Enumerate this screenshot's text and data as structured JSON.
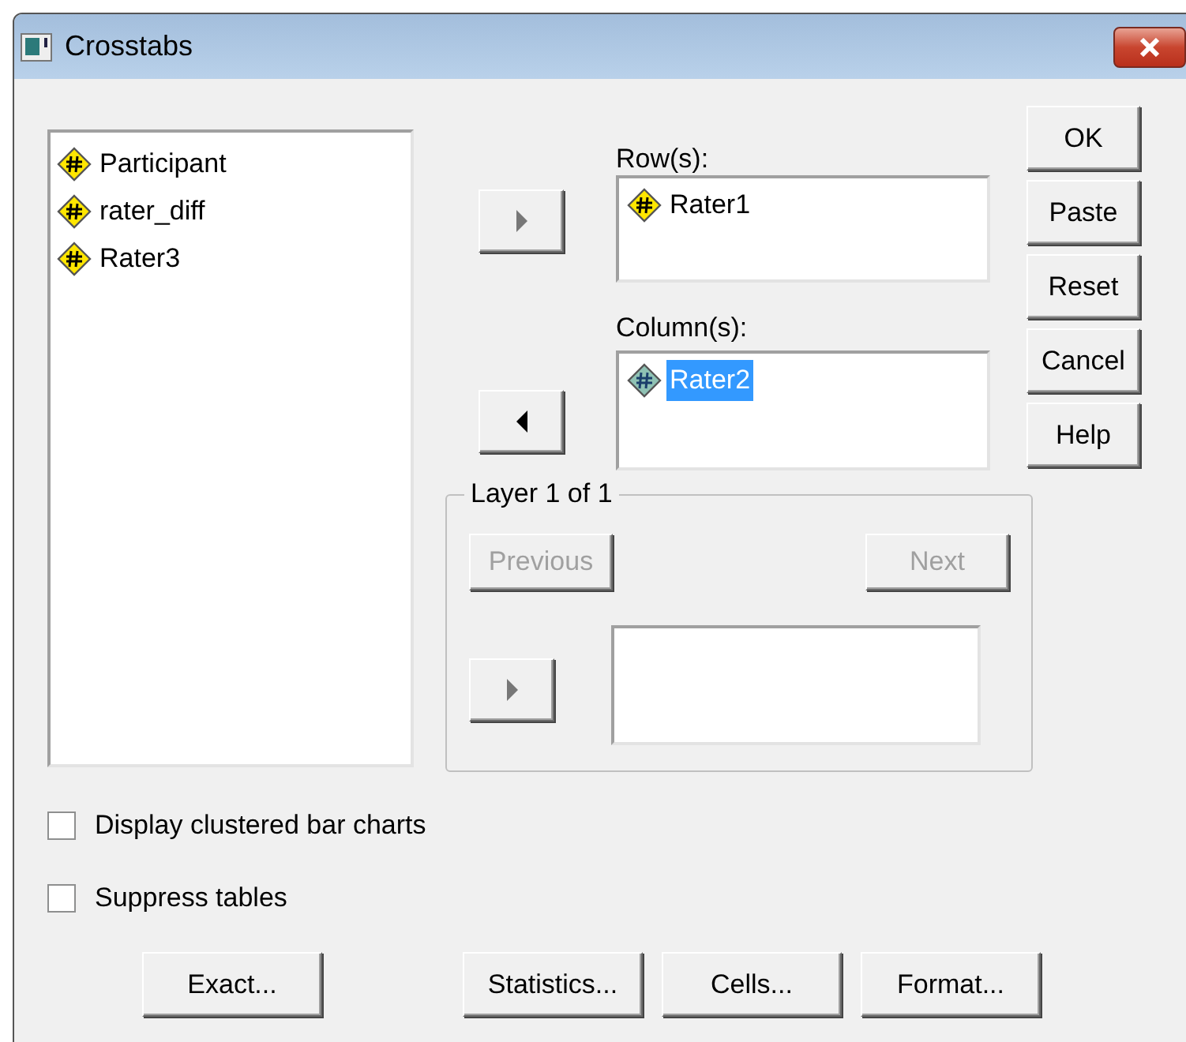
{
  "window": {
    "title": "Crosstabs"
  },
  "source_variables": [
    {
      "name": "Participant",
      "selected": false
    },
    {
      "name": "rater_diff",
      "selected": false
    },
    {
      "name": "Rater3",
      "selected": false
    }
  ],
  "rows": {
    "label": "Row(s):",
    "arrow_points_left": false,
    "variables": [
      {
        "name": "Rater1",
        "selected": false
      }
    ]
  },
  "columns": {
    "label": "Column(s):",
    "arrow_points_left": true,
    "variables": [
      {
        "name": "Rater2",
        "selected": true
      }
    ]
  },
  "layer": {
    "title": "Layer 1 of 1",
    "previous": {
      "label": "Previous",
      "disabled": true
    },
    "next": {
      "label": "Next",
      "disabled": true
    },
    "arrow_points_left": false
  },
  "side_buttons": [
    "OK",
    "Paste",
    "Reset",
    "Cancel",
    "Help"
  ],
  "options": [
    {
      "label": "Display clustered bar charts",
      "checked": false
    },
    {
      "label": "Suppress tables",
      "checked": false
    }
  ],
  "bottom_buttons": [
    "Exact...",
    "Statistics...",
    "Cells...",
    "Format..."
  ]
}
